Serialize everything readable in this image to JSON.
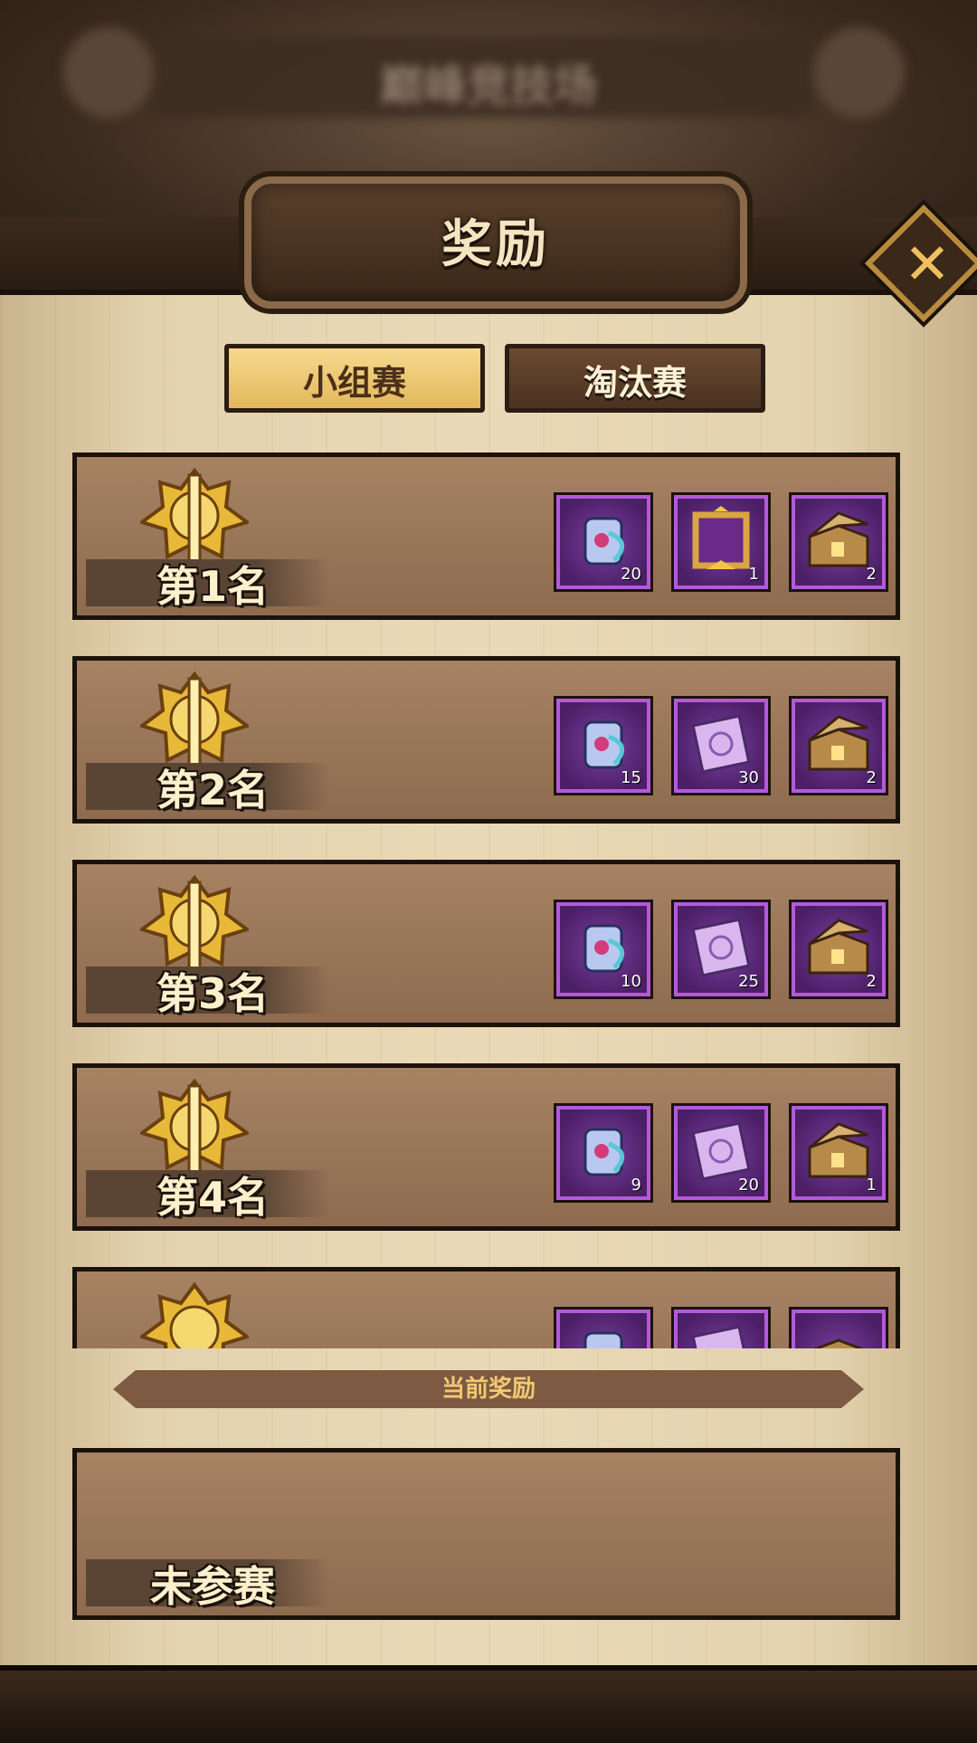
{
  "background": {
    "banner_text": "巅峰竞技场"
  },
  "header": {
    "title": "奖励"
  },
  "tabs": [
    {
      "label": "小组赛",
      "active": true
    },
    {
      "label": "淘汰赛",
      "active": false
    }
  ],
  "rewards": [
    {
      "rank": "第1名",
      "items": [
        {
          "icon": "scroll-icon",
          "count": "20"
        },
        {
          "icon": "avatar-frame-icon",
          "count": "1"
        },
        {
          "icon": "treasure-chest-icon",
          "count": "2"
        }
      ]
    },
    {
      "rank": "第2名",
      "items": [
        {
          "icon": "scroll-icon",
          "count": "15"
        },
        {
          "icon": "stamp-ticket-icon",
          "count": "30"
        },
        {
          "icon": "treasure-chest-icon",
          "count": "2"
        }
      ]
    },
    {
      "rank": "第3名",
      "items": [
        {
          "icon": "scroll-icon",
          "count": "10"
        },
        {
          "icon": "stamp-ticket-icon",
          "count": "25"
        },
        {
          "icon": "treasure-chest-icon",
          "count": "2"
        }
      ]
    },
    {
      "rank": "第4名",
      "items": [
        {
          "icon": "scroll-icon",
          "count": "9"
        },
        {
          "icon": "stamp-ticket-icon",
          "count": "20"
        },
        {
          "icon": "treasure-chest-icon",
          "count": "1"
        }
      ]
    },
    {
      "rank": "",
      "items": [
        {
          "icon": "scroll-icon",
          "count": ""
        },
        {
          "icon": "stamp-ticket-icon",
          "count": ""
        },
        {
          "icon": "treasure-chest-icon",
          "count": ""
        }
      ]
    }
  ],
  "current_reward": {
    "title": "当前奖励",
    "status": "未参赛"
  },
  "colors": {
    "accent_gold": "#f2c872",
    "item_border": "#b35ad8",
    "panel": "#ead9b6"
  }
}
